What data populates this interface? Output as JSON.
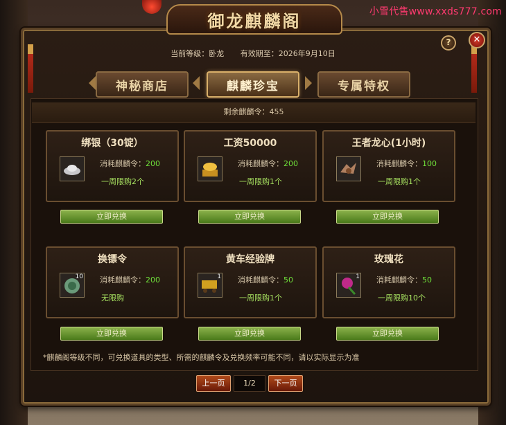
{
  "watermark": "小雪代售www.xxds777.com",
  "window": {
    "title": "御龙麒麟阁",
    "help": "?",
    "close": "✕"
  },
  "info": {
    "level_label": "当前等级：卧龙",
    "expiry_label": "有效期至：2026年9月10日"
  },
  "tabs": [
    {
      "label": "神秘商店"
    },
    {
      "label": "麒麟珍宝"
    },
    {
      "label": "专属特权"
    }
  ],
  "remaining": "剩余麒麟令：455",
  "cost_label": "消耗麒麟令：",
  "items": [
    {
      "name": "绑银（30锭）",
      "cost": "200",
      "limit": "一周限购2个",
      "qty": "",
      "icon": "silver-ingot-icon"
    },
    {
      "name": "工资50000",
      "cost": "200",
      "limit": "一周限购1个",
      "qty": "",
      "icon": "gold-coins-icon"
    },
    {
      "name": "王者龙心(1小时)",
      "cost": "100",
      "limit": "一周限购1个",
      "qty": "",
      "icon": "dragon-heart-icon"
    },
    {
      "name": "换镖令",
      "cost": "200",
      "limit": "无限购",
      "qty": "10",
      "icon": "escort-token-icon"
    },
    {
      "name": "黄车经验牌",
      "cost": "50",
      "limit": "一周限购1个",
      "qty": "1",
      "icon": "yellow-cart-icon"
    },
    {
      "name": "玫瑰花",
      "cost": "50",
      "limit": "一周限购10个",
      "qty": "1",
      "icon": "rose-icon"
    }
  ],
  "exchange_label": "立即兑换",
  "note": "*麒麟阁等级不同，可兑换道具的类型、所需的麒麟令及兑换频率可能不同，请以实际显示为准",
  "pager": {
    "prev": "上一页",
    "page": "1/2",
    "next": "下一页"
  }
}
